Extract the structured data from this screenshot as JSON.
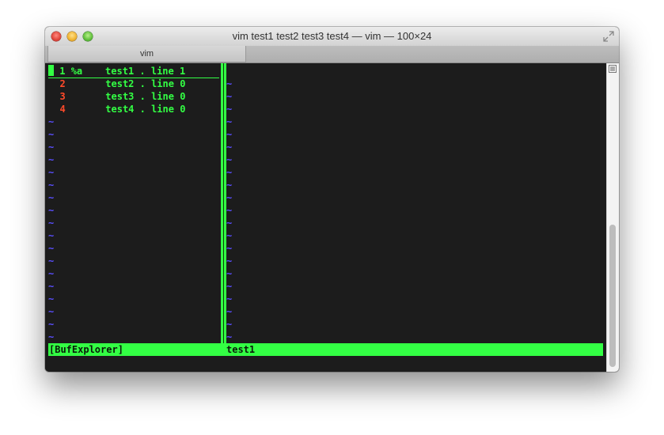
{
  "window": {
    "title": "vim test1 test2 test3 test4 — vim — 100×24",
    "tab_label": "vim"
  },
  "bufexplorer": {
    "rows": [
      {
        "num": "1",
        "flags": "%a",
        "name": "test1 . line 1",
        "selected": true
      },
      {
        "num": "2",
        "flags": "",
        "name": "test2 . line 0",
        "selected": false
      },
      {
        "num": "3",
        "flags": "",
        "name": "test3 . line 0",
        "selected": false
      },
      {
        "num": "4",
        "flags": "",
        "name": "test4 . line 0",
        "selected": false
      }
    ],
    "tilde": "~"
  },
  "status": {
    "left": "[BufExplorer]",
    "right": "test1"
  },
  "colors": {
    "accent_green": "#33ff44",
    "buffer_number_red": "#ff4a2a",
    "tilde_blue": "#5a4fff",
    "terminal_bg": "#1c1c1c"
  },
  "icons": {
    "fullscreen": "fullscreen-arrows-icon",
    "scrollbar_menu": "list-icon"
  }
}
